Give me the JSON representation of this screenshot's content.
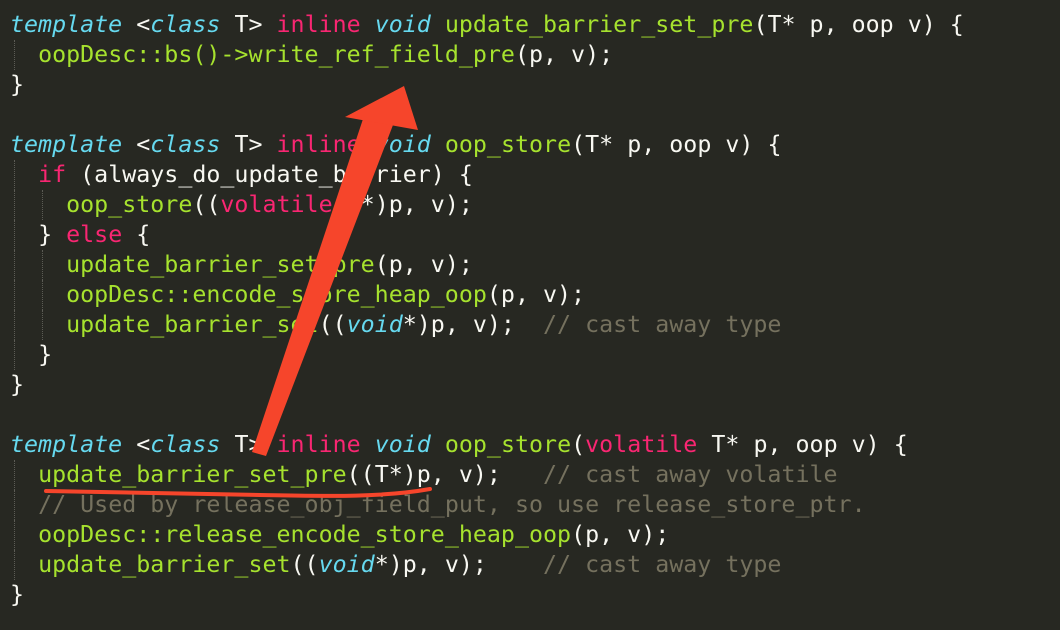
{
  "code": {
    "block1": {
      "line1": {
        "t1": "template",
        "t2": " <",
        "t3": "class",
        "t4": " T> ",
        "t5": "inline",
        "t6": " ",
        "t7": "void",
        "t8": " ",
        "t9": "update_barrier_set_pre",
        "t10": "(T* p, oop v) {"
      },
      "line2": {
        "t1": "oopDesc::bs()->",
        "t2": "write_ref_field_pre",
        "t3": "(p, v);"
      },
      "line3": {
        "t1": "}"
      }
    },
    "block2": {
      "line1": {
        "t1": "template",
        "t2": " <",
        "t3": "class",
        "t4": " T> ",
        "t5": "inline",
        "t6": " ",
        "t7": "void",
        "t8": " ",
        "t9": "oop_store",
        "t10": "(T* p, oop v) {"
      },
      "line2": {
        "t1": "if",
        "t2": " (always_do_update_barrier) {"
      },
      "line3": {
        "t1": "oop_store",
        "t2": "((",
        "t3": "volatile",
        "t4": " T*)p, v);"
      },
      "line4": {
        "t1": "} ",
        "t2": "else",
        "t3": " {"
      },
      "line5": {
        "t1": "update_barrier_set_pre",
        "t2": "(p, v);"
      },
      "line6": {
        "t1": "oopDesc::encode_store_heap_oop",
        "t2": "(p, v);"
      },
      "line7": {
        "t1": "update_barrier_set",
        "t2": "((",
        "t3": "void",
        "t4": "*)p, v);  ",
        "t5": "// cast away type"
      },
      "line8": {
        "t1": "}"
      },
      "line9": {
        "t1": "}"
      }
    },
    "block3": {
      "line1": {
        "t1": "template",
        "t2": " <",
        "t3": "class",
        "t4": " T> ",
        "t5": "inline",
        "t6": " ",
        "t7": "void",
        "t8": " ",
        "t9": "oop_store",
        "t10": "(",
        "t11": "volatile",
        "t12": " T* p, oop v) {"
      },
      "line2": {
        "t1": "update_barrier_set_pre",
        "t2": "((T*)p, v);   ",
        "t3": "// cast away volatile"
      },
      "line3": {
        "t1": "// Used by release_obj_field_put, so use release_store_ptr."
      },
      "line4": {
        "t1": "oopDesc::release_encode_store_heap_oop",
        "t2": "(p, v);"
      },
      "line5": {
        "t1": "update_barrier_set",
        "t2": "((",
        "t3": "void",
        "t4": "*)p, v);    ",
        "t5": "// cast away type"
      },
      "line6": {
        "t1": "}"
      }
    }
  },
  "colors": {
    "background": "#272822",
    "keyword_italic": "#66d9ef",
    "keyword": "#f92672",
    "function": "#a6e22e",
    "comment": "#75715e",
    "plain": "#f8f8f2",
    "annotation": "#f6452b"
  },
  "annotations": {
    "arrow_icon": "arrow-annotation-icon",
    "underline_icon": "underline-annotation-icon"
  }
}
